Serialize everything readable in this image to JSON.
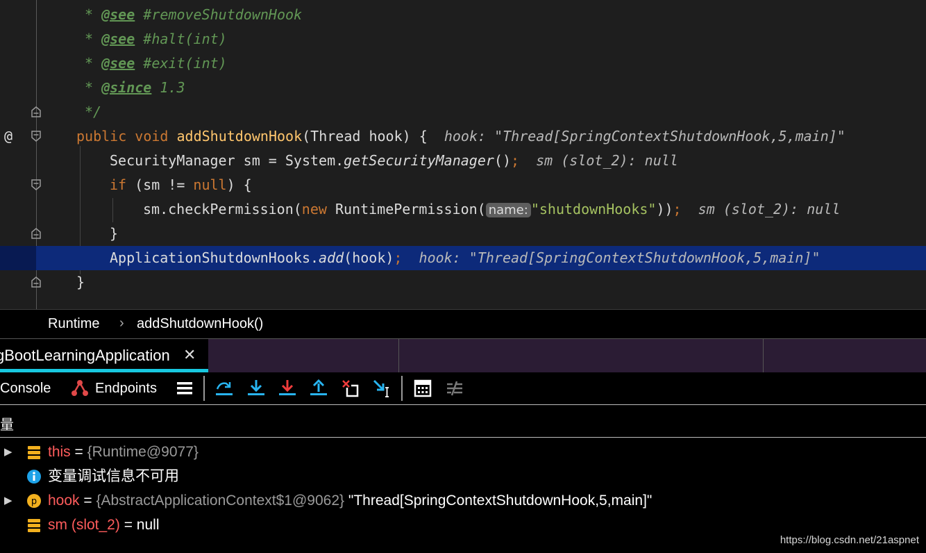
{
  "editor": {
    "lines": [
      {
        "segments": [
          {
            "t": "* ",
            "c": "c-com"
          },
          {
            "t": "@see",
            "c": "c-tag"
          },
          {
            "t": " #removeShutdownHook",
            "c": "c-com"
          }
        ]
      },
      {
        "segments": [
          {
            "t": "* ",
            "c": "c-com"
          },
          {
            "t": "@see",
            "c": "c-tag"
          },
          {
            "t": " #halt(int)",
            "c": "c-com"
          }
        ]
      },
      {
        "segments": [
          {
            "t": "* ",
            "c": "c-com"
          },
          {
            "t": "@see",
            "c": "c-tag"
          },
          {
            "t": " #exit(int)",
            "c": "c-com"
          }
        ]
      },
      {
        "segments": [
          {
            "t": "* ",
            "c": "c-com"
          },
          {
            "t": "@since",
            "c": "c-tag"
          },
          {
            "t": " 1.3",
            "c": "c-com"
          }
        ]
      },
      {
        "segments": [
          {
            "t": "*/",
            "c": "c-com"
          }
        ]
      },
      {
        "segments": [
          {
            "t": "public ",
            "c": "c-kw"
          },
          {
            "t": "void ",
            "c": "c-kw"
          },
          {
            "t": "addShutdownHook",
            "c": "c-fn"
          },
          {
            "t": "(Thread hook) {  ",
            "c": ""
          },
          {
            "t": "hook: \"Thread[SpringContextShutdownHook,5,main]\"",
            "c": "c-inl"
          }
        ]
      },
      {
        "segments": [
          {
            "t": "SecurityManager sm = System.",
            "c": ""
          },
          {
            "t": "getSecurityManager",
            "c": "c-it"
          },
          {
            "t": "()",
            "c": ""
          },
          {
            "t": ";",
            "c": "c-kw"
          },
          {
            "t": "  sm (slot_2): null",
            "c": "c-inl"
          }
        ]
      },
      {
        "segments": [
          {
            "t": "if ",
            "c": "c-kw"
          },
          {
            "t": "(sm != ",
            "c": ""
          },
          {
            "t": "null",
            "c": "c-kw"
          },
          {
            "t": ") {",
            "c": ""
          }
        ]
      },
      {
        "segments": [
          {
            "t": "sm.checkPermission(",
            "c": ""
          },
          {
            "t": "new ",
            "c": "c-kw"
          },
          {
            "t": "RuntimePermission(",
            "c": ""
          },
          {
            "t": "name:",
            "c": "c-par"
          },
          {
            "t": "\"shutdownHooks\"",
            "c": "c-str2"
          },
          {
            "t": "))",
            "c": ""
          },
          {
            "t": ";",
            "c": "c-kw"
          },
          {
            "t": "  sm (slot_2): null",
            "c": "c-inl"
          }
        ]
      },
      {
        "segments": [
          {
            "t": "}",
            "c": ""
          }
        ]
      },
      {
        "segments": [
          {
            "t": "ApplicationShutdownHooks.",
            "c": ""
          },
          {
            "t": "add",
            "c": "c-it"
          },
          {
            "t": "(hook)",
            "c": ""
          },
          {
            "t": ";",
            "c": "c-kw"
          },
          {
            "t": "  hook: \"Thread[SpringContextShutdownHook,5,main]\"",
            "c": "c-inl"
          }
        ]
      },
      {
        "segments": [
          {
            "t": "}",
            "c": ""
          }
        ]
      }
    ],
    "override_marker": "@"
  },
  "breadcrumb": {
    "class_name": "Runtime",
    "separator": "›",
    "method": "addShutdownHook()"
  },
  "tabs": {
    "active_label": "gBootLearningApplication",
    "close": "✕"
  },
  "toolbar": {
    "console_label": "Console",
    "endpoints_label": "Endpoints"
  },
  "variables": {
    "header": "量",
    "rows": [
      {
        "name": "this",
        "eq": " = ",
        "type": "{Runtime@9077}",
        "value": "",
        "icon": "field-icon",
        "expandable": true
      },
      {
        "name": "",
        "eq": "",
        "type": "",
        "value": "变量调试信息不可用",
        "icon": "info-icon",
        "expandable": false
      },
      {
        "name": "hook",
        "eq": " = ",
        "type": "{AbstractApplicationContext$1@9062}",
        "value": " \"Thread[SpringContextShutdownHook,5,main]\"",
        "icon": "param-icon",
        "expandable": true
      },
      {
        "name": "sm (slot_2)",
        "eq": " = ",
        "type": "",
        "value": "null",
        "icon": "field-icon",
        "expandable": false
      }
    ]
  },
  "watermark": "https://blog.csdn.net/21aspnet"
}
